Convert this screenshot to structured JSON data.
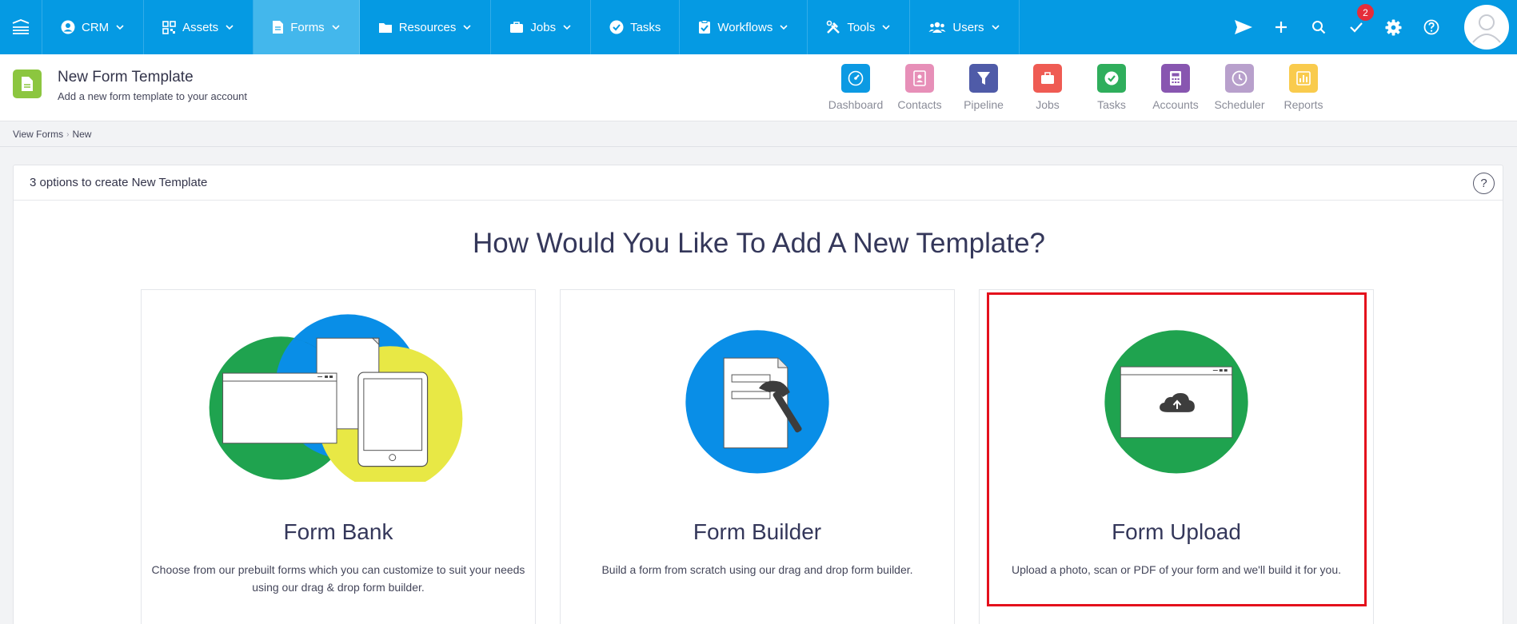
{
  "nav": {
    "items": [
      {
        "label": "CRM",
        "icon": "user-circle-icon",
        "dropdown": true
      },
      {
        "label": "Assets",
        "icon": "qr-code-icon",
        "dropdown": true
      },
      {
        "label": "Forms",
        "icon": "document-icon",
        "dropdown": true,
        "active": true
      },
      {
        "label": "Resources",
        "icon": "folder-icon",
        "dropdown": true
      },
      {
        "label": "Jobs",
        "icon": "briefcase-icon",
        "dropdown": true
      },
      {
        "label": "Tasks",
        "icon": "check-circle-icon",
        "dropdown": false
      },
      {
        "label": "Workflows",
        "icon": "clipboard-check-icon",
        "dropdown": true
      },
      {
        "label": "Tools",
        "icon": "tools-icon",
        "dropdown": true
      },
      {
        "label": "Users",
        "icon": "users-icon",
        "dropdown": true
      }
    ],
    "notification_count": "2",
    "colors": {
      "bar": "#059ae3",
      "active": "#43b7ec",
      "badge": "#e52d3a"
    }
  },
  "header": {
    "title": "New Form Template",
    "subtitle": "Add a new form template to your account",
    "quick_links": [
      {
        "label": "Dashboard",
        "icon": "speedometer-icon",
        "color": "#0c9ae3"
      },
      {
        "label": "Contacts",
        "icon": "contact-book-icon",
        "color": "#e78fb8"
      },
      {
        "label": "Pipeline",
        "icon": "funnel-icon",
        "color": "#4f5ba8"
      },
      {
        "label": "Jobs",
        "icon": "briefcase-icon",
        "color": "#ef5b53"
      },
      {
        "label": "Tasks",
        "icon": "check-circle-icon",
        "color": "#2fae5c"
      },
      {
        "label": "Accounts",
        "icon": "calculator-icon",
        "color": "#8856b0"
      },
      {
        "label": "Scheduler",
        "icon": "clock-icon",
        "color": "#b8a0cc"
      },
      {
        "label": "Reports",
        "icon": "bar-chart-icon",
        "color": "#f9cb4d"
      }
    ]
  },
  "breadcrumb": [
    "View Forms",
    "New"
  ],
  "card": {
    "header_title": "3 options to create New Template",
    "help_label": "?",
    "heading": "How Would You Like To Add A New Template?",
    "options": [
      {
        "title": "Form Bank",
        "description": "Choose from our prebuilt forms which you can customize to suit your needs using our drag & drop form builder."
      },
      {
        "title": "Form Builder",
        "description": "Build a form from scratch using our drag and drop form builder."
      },
      {
        "title": "Form Upload",
        "description": "Upload a photo, scan or PDF of your form and we'll build it for you.",
        "highlighted": true
      }
    ]
  }
}
